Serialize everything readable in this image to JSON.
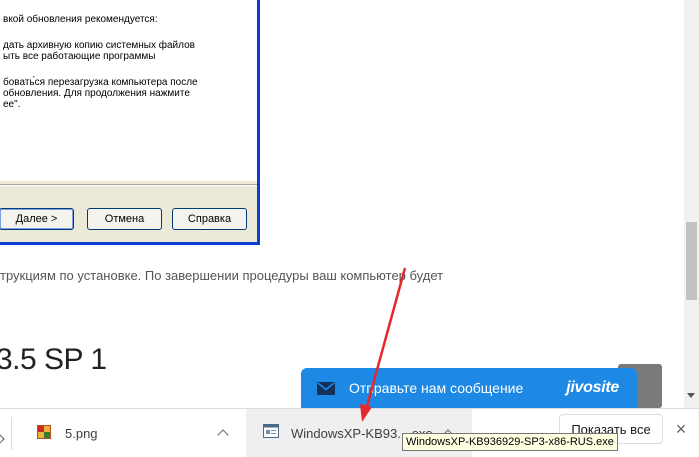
{
  "dialog": {
    "lines": [
      "вкой обновления рекомендуется:",
      "дать архивную копию системных файлов",
      "ыть все работающие программы",
      "бовать́ся перезагрузка компьютера после",
      "обновления. Для продолжения нажмите",
      "ее\"."
    ],
    "buttons": {
      "next": "Далее >",
      "cancel": "Отмена",
      "help": "Справка"
    }
  },
  "article": {
    "line": "трукциям по установке. По завершении процедуры ваш компьютер будет",
    "heading": "3.5 SP 1"
  },
  "jivo": {
    "message": "Отправьте нам сообщение",
    "brand": "jivosite",
    "icon": "mail-icon"
  },
  "downloads": {
    "items": [
      {
        "name": "5.png",
        "icon": "png-file-icon"
      },
      {
        "name": "WindowsXP-KB93....exe",
        "icon": "exe-file-icon"
      }
    ],
    "show_all": "Показать все",
    "tooltip": "WindowsXP-KB936929-SP3-x86-RUS.exe"
  },
  "colors": {
    "jivo_blue": "#1e88e5",
    "arrow_red": "#e5282b",
    "xp_border": "#0a3fd3"
  }
}
